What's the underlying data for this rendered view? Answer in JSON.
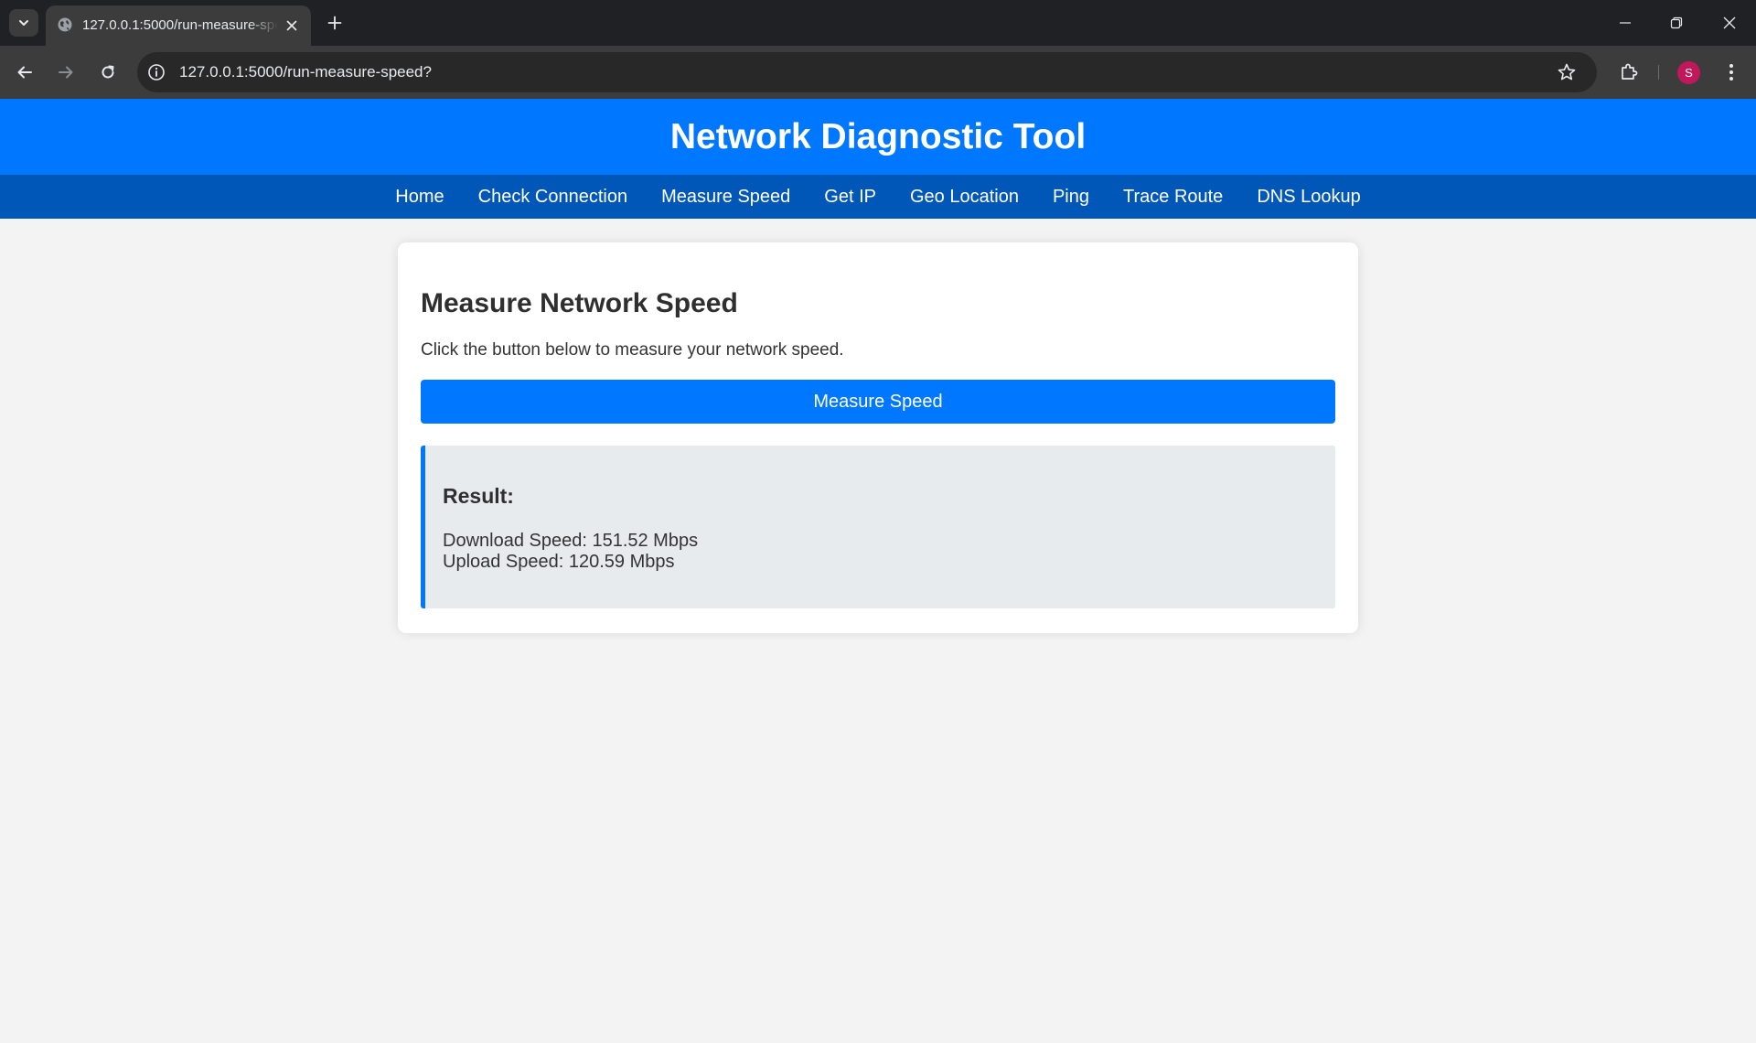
{
  "browser": {
    "tab_title": "127.0.0.1:5000/run-measure-speed?",
    "url": "127.0.0.1:5000/run-measure-speed?",
    "profile_initial": "S"
  },
  "site": {
    "title": "Network Diagnostic Tool",
    "nav": [
      {
        "label": "Home"
      },
      {
        "label": "Check Connection"
      },
      {
        "label": "Measure Speed"
      },
      {
        "label": "Get IP"
      },
      {
        "label": "Geo Location"
      },
      {
        "label": "Ping"
      },
      {
        "label": "Trace Route"
      },
      {
        "label": "DNS Lookup"
      }
    ]
  },
  "main": {
    "heading": "Measure Network Speed",
    "description": "Click the button below to measure your network speed.",
    "button_label": "Measure Speed",
    "result": {
      "title": "Result:",
      "download": "Download Speed: 151.52 Mbps",
      "upload": "Upload Speed: 120.59 Mbps"
    }
  },
  "colors": {
    "header_bg": "#0077ff",
    "nav_bg": "#0057b8",
    "button_bg": "#0077ff",
    "result_bg": "#e8ebee",
    "page_bg": "#f3f3f3"
  }
}
